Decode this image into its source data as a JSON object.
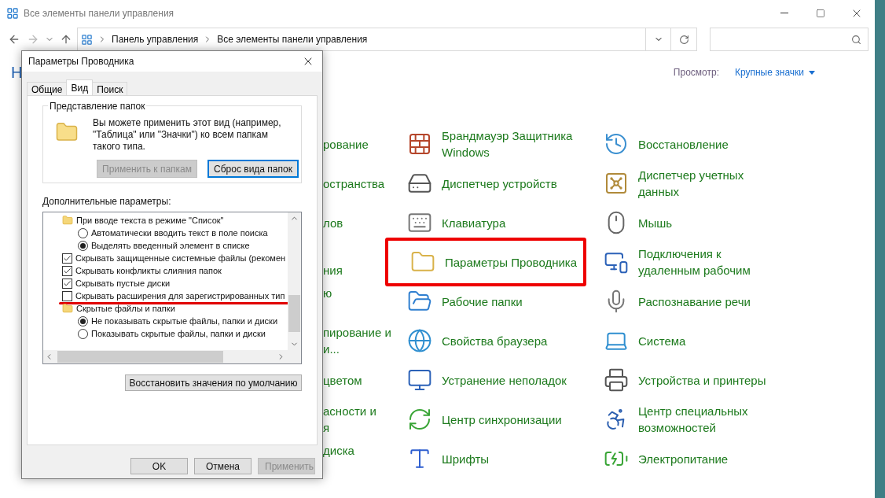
{
  "window": {
    "title": "Все элементы панели управления"
  },
  "address_bar": {
    "path": [
      "Панель управления",
      "Все элементы панели управления"
    ]
  },
  "heading_fragment": "Н",
  "view": {
    "label": "Просмотр:",
    "value": "Крупные значки"
  },
  "partial_column": [
    {
      "text": "рование"
    },
    {
      "text": "остранства"
    },
    {
      "text": "лов"
    },
    {
      "line_2": "ния"
    },
    {
      "line_1": "ю"
    },
    {
      "line_1": "пирование и",
      "line_2": "и..."
    },
    {
      "text": "цветом"
    },
    {
      "line_1": "асности и",
      "line_2": "я"
    },
    {
      "line_1": "диска"
    }
  ],
  "columns": [
    {
      "items": [
        {
          "label": "Брандмауэр Защитника Windows",
          "highlighted": false
        },
        {
          "label": "Диспетчер устройств",
          "highlighted": false
        },
        {
          "label": "Клавиатура",
          "highlighted": false
        },
        {
          "label": "Параметры Проводника",
          "highlighted": true
        },
        {
          "label": "Рабочие папки",
          "highlighted": false
        },
        {
          "label": "Свойства браузера",
          "highlighted": false
        },
        {
          "label": "Устранение неполадок",
          "highlighted": false
        },
        {
          "label": "Центр синхронизации",
          "highlighted": false
        },
        {
          "label": "Шрифты",
          "highlighted": false
        }
      ]
    },
    {
      "items": [
        {
          "label": "Восстановление",
          "highlighted": false
        },
        {
          "label": "Диспетчер учетных данных",
          "highlighted": false
        },
        {
          "label": "Мышь",
          "highlighted": false
        },
        {
          "label": "Подключения к удаленным рабочим",
          "highlighted": false
        },
        {
          "label": "Распознавание речи",
          "highlighted": false
        },
        {
          "label": "Система",
          "highlighted": false
        },
        {
          "label": "Устройства и принтеры",
          "highlighted": false
        },
        {
          "label": "Центр специальных возможностей",
          "highlighted": false
        },
        {
          "label": "Электропитание",
          "highlighted": false
        }
      ]
    }
  ],
  "dialog": {
    "title": "Параметры Проводника",
    "tabs": [
      {
        "label": "Общие",
        "selected": false
      },
      {
        "label": "Вид",
        "selected": true
      },
      {
        "label": "Поиск",
        "selected": false
      }
    ],
    "folder_views": {
      "title": "Представление папок",
      "text": "Вы можете применить этот вид (например, \"Таблица\" или \"Значки\") ко всем папкам такого типа.",
      "buttons": [
        {
          "label": "Применить к папкам",
          "disabled": true,
          "focused": false
        },
        {
          "label": "Сброс вида папок",
          "disabled": false,
          "focused": true
        }
      ]
    },
    "advanced": {
      "label": "Дополнительные параметры:",
      "items": [
        {
          "kind": "folder",
          "label": "При вводе текста в режиме \"Список\"",
          "children": [
            {
              "kind": "radio",
              "label": "Автоматически вводить текст в поле поиска",
              "selected": false
            },
            {
              "kind": "radio",
              "label": "Выделять введенный элемент в списке",
              "selected": true
            }
          ]
        },
        {
          "kind": "checkbox",
          "label": "Скрывать защищенные системные файлы (рекомен",
          "checked": true,
          "underlined": false
        },
        {
          "kind": "checkbox",
          "label": "Скрывать конфликты слияния папок",
          "checked": true,
          "underlined": false
        },
        {
          "kind": "checkbox",
          "label": "Скрывать пустые диски",
          "checked": true,
          "underlined": false
        },
        {
          "kind": "checkbox",
          "label": "Скрывать расширения для зарегистрированных тип",
          "checked": false,
          "underlined": true
        },
        {
          "kind": "folder",
          "label": "Скрытые файлы и папки",
          "children": [
            {
              "kind": "radio",
              "label": "Не показывать скрытые файлы, папки и диски",
              "selected": true
            },
            {
              "kind": "radio",
              "label": "Показывать скрытые файлы, папки и диски",
              "selected": false
            }
          ]
        }
      ],
      "restore_button": "Восстановить значения по умолчанию"
    },
    "buttons": [
      {
        "label": "OK",
        "disabled": false
      },
      {
        "label": "Отмена",
        "disabled": false
      },
      {
        "label": "Применить",
        "disabled": true
      }
    ]
  }
}
